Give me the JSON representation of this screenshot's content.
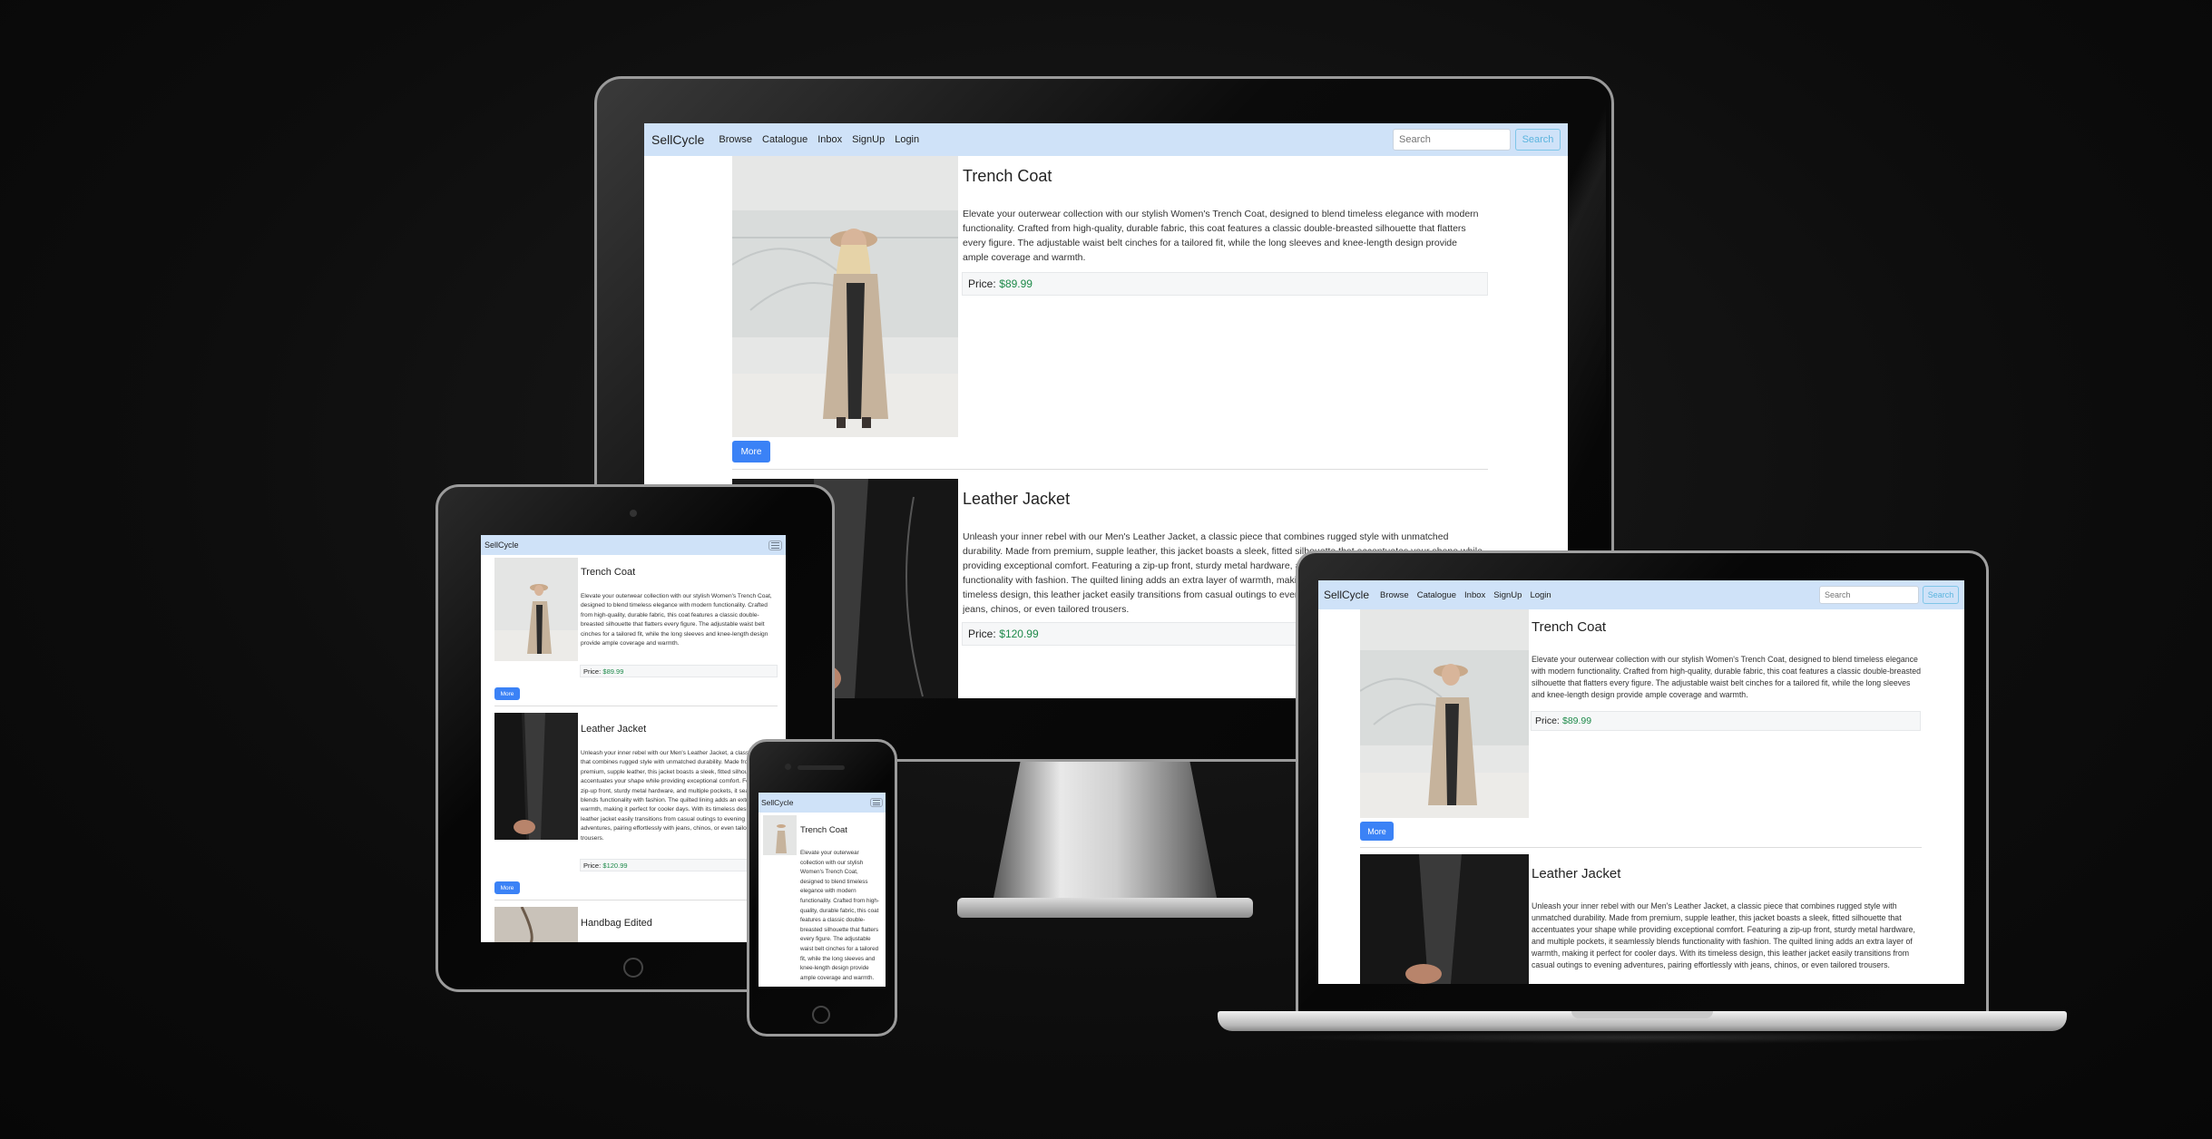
{
  "brand": "SellCycle",
  "nav": [
    "Browse",
    "Catalogue",
    "Inbox",
    "SignUp",
    "Login"
  ],
  "search": {
    "placeholder": "Search",
    "button": "Search"
  },
  "price_label": "Price:",
  "more_label": "More",
  "products": [
    {
      "title": "Trench Coat",
      "price": "$89.99",
      "description": "Elevate your outerwear collection with our stylish Women's Trench Coat, designed to blend timeless elegance with modern functionality. Crafted from high-quality, durable fabric, this coat features a classic double-breasted silhouette that flatters every figure. The adjustable waist belt cinches for a tailored fit, while the long sleeves and knee-length design provide ample coverage and warmth."
    },
    {
      "title": "Leather Jacket",
      "price": "$120.99",
      "description": "Unleash your inner rebel with our Men's Leather Jacket, a classic piece that combines rugged style with unmatched durability. Made from premium, supple leather, this jacket boasts a sleek, fitted silhouette that accentuates your shape while providing exceptional comfort. Featuring a zip-up front, sturdy metal hardware, and multiple pockets, it seamlessly blends functionality with fashion. The quilted lining adds an extra layer of warmth, making it perfect for cooler days. With its timeless design, this leather jacket easily transitions from casual outings to evening adventures, pairing effortlessly with jeans, chinos, or even tailored trousers."
    },
    {
      "title": "Handbag Edited",
      "price": "",
      "description": ""
    }
  ],
  "colors": {
    "navbar": "#cfe2f8",
    "button": "#3b82f6",
    "price": "#1e8a4a",
    "search_outline": "#5ab4de"
  },
  "icons": {
    "menu": "hamburger-menu-icon",
    "home": "home-button-icon"
  }
}
